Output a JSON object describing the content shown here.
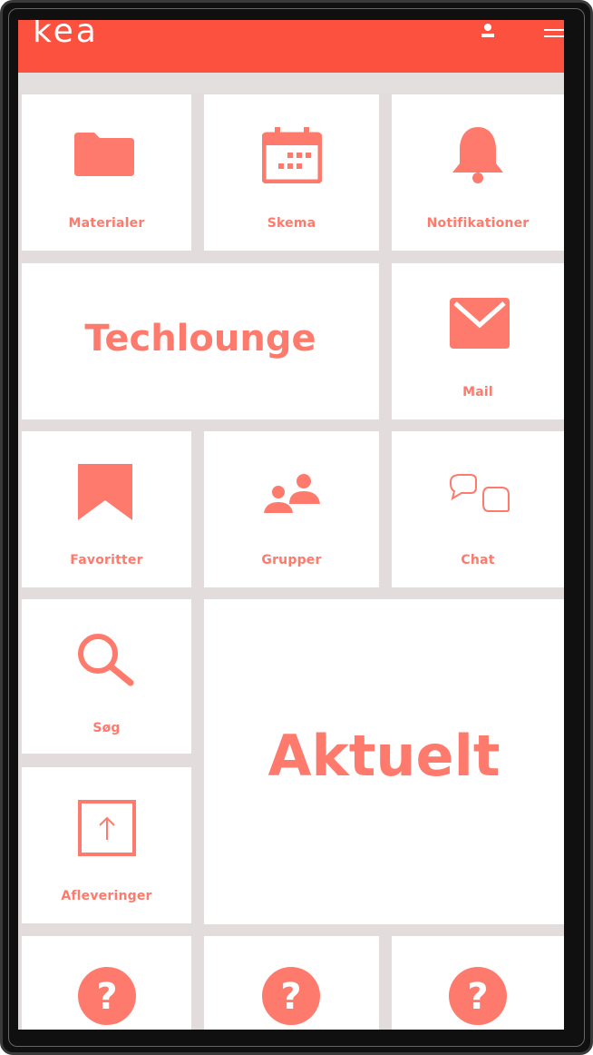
{
  "app": {
    "logo_text": "kea"
  },
  "colors": {
    "brand": "#fd5140",
    "tile_accent": "#fd7a6c",
    "background": "#e2dcdc"
  },
  "tiles": {
    "materialer": {
      "label": "Materialer",
      "icon": "folder-icon"
    },
    "skema": {
      "label": "Skema",
      "icon": "calendar-icon"
    },
    "notifikationer": {
      "label": "Notifikationer",
      "icon": "bell-icon"
    },
    "techlounge": {
      "label": "Techlounge"
    },
    "mail": {
      "label": "Mail",
      "icon": "envelope-icon"
    },
    "favoritter": {
      "label": "Favoritter",
      "icon": "bookmark-icon"
    },
    "grupper": {
      "label": "Grupper",
      "icon": "people-icon"
    },
    "chat": {
      "label": "Chat",
      "icon": "chat-bubbles-icon"
    },
    "soeg": {
      "label": "Søg",
      "icon": "search-icon"
    },
    "aktuelt": {
      "label": "Aktuelt"
    },
    "afleveringer": {
      "label": "Afleveringer",
      "icon": "upload-icon"
    },
    "unknown": {
      "icon": "question-icon"
    }
  }
}
